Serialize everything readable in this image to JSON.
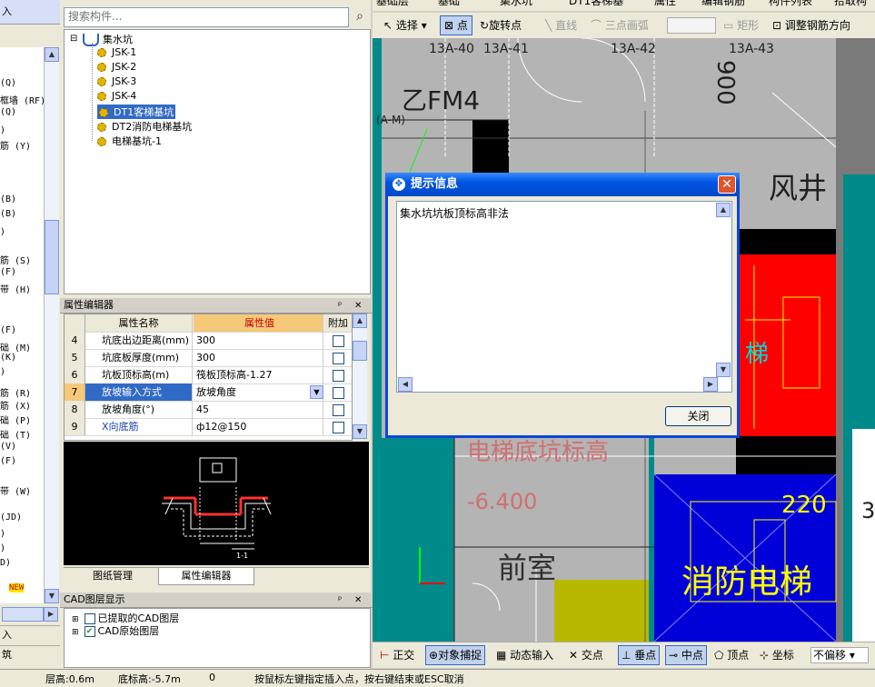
{
  "left_panel": {
    "header": "入",
    "items": [
      "(Q)",
      "框墙 (RF)",
      "(Q)",
      ")",
      "筋 (Y)",
      "(B)",
      "(B)",
      ")",
      "筋 (S)",
      "(F)",
      "带 (H)",
      "(F)",
      "础 (M)",
      "(K)",
      ")",
      "筋 (R)",
      "筋 (X)",
      "础 (P)",
      "础 (T)",
      "(V)",
      "(F)",
      "带 (W)",
      "(JD)",
      ")",
      ")",
      "D)",
      "NEW"
    ],
    "bottom_items": [
      "入",
      "筑"
    ]
  },
  "search": {
    "placeholder": "搜索构件..."
  },
  "tree": {
    "root": "集水坑",
    "children": [
      "JSK-1",
      "JSK-2",
      "JSK-3",
      "JSK-4",
      "DT1客梯基坑",
      "DT2消防电梯基坑",
      "电梯基坑-1"
    ]
  },
  "property_editor": {
    "title": "属性编辑器",
    "headers": {
      "name": "属性名称",
      "value": "属性值",
      "extra": "附加"
    },
    "rows": [
      {
        "num": "4",
        "name": "坑底出边距离(mm)",
        "value": "300"
      },
      {
        "num": "5",
        "name": "坑底板厚度(mm)",
        "value": "300"
      },
      {
        "num": "6",
        "name": "坑板顶标高(m)",
        "value": "筏板顶标高-1.27"
      },
      {
        "num": "7",
        "name": "放坡输入方式",
        "value": "放坡角度"
      },
      {
        "num": "8",
        "name": "放坡角度(°)",
        "value": "45"
      },
      {
        "num": "9",
        "name": "X向底筋",
        "value": "ф12@150"
      }
    ]
  },
  "preview": {
    "section_label": "1-1"
  },
  "mid_tabs": [
    "图纸管理",
    "属性编辑器"
  ],
  "cad_layers": {
    "title": "CAD图层显示",
    "items": [
      {
        "label": "已提取的CAD图层",
        "checked": false
      },
      {
        "label": "CAD原始图层",
        "checked": true
      }
    ]
  },
  "top_toolbar": {
    "row1": [
      "基础层",
      "基础",
      "集水坑",
      "DT1客梯基",
      "属性",
      "编辑钢筋",
      "构件列表",
      "拾取构"
    ],
    "row2": [
      "选择",
      "点",
      "旋转点",
      "直线",
      "三点画弧",
      "矩形",
      "调整钢筋方向"
    ]
  },
  "drawing": {
    "labels": {
      "axis1": "13A-40",
      "axis2": "13A-41",
      "axis3": "13A-42",
      "axis4": "13A-43",
      "door": "乙FM4",
      "dim": "900",
      "shaft": "风井",
      "axis_m": "(A-M)",
      "stair_char": "梯",
      "pit_label": "电梯底坑标高",
      "pit_value": "-6.400",
      "lobby": "前室",
      "fire_elevator": "消防电梯",
      "num220": "220",
      "edge": "3"
    }
  },
  "bottom_toolbar": [
    "正交",
    "对象捕捉",
    "动态输入",
    "交点",
    "垂点",
    "中点",
    "顶点",
    "坐标",
    "不偏移"
  ],
  "status_bar": {
    "floor_height": "层高:0.6m",
    "bottom_elev": "底标高:-5.7m",
    "value": "0",
    "hint": "按鼠标左键指定插入点，按右键结束或ESC取消"
  },
  "dialog": {
    "title": "提示信息",
    "message": "集水坑坑板顶标高非法",
    "close_button": "关闭"
  },
  "colors": {
    "red_zone": "#ff0000",
    "blue_zone": "#0000d8",
    "teal": "#008a8a",
    "gray": "#b4b4b4"
  }
}
